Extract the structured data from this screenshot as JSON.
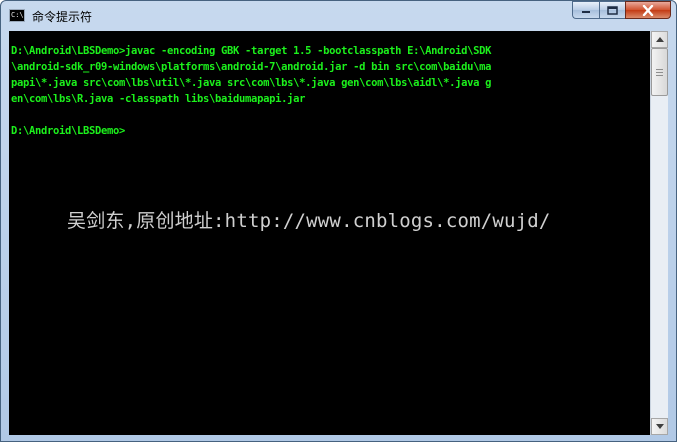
{
  "window": {
    "title": "命令提示符",
    "icon": "cmd-icon",
    "icon_text": "C:\\"
  },
  "controls": {
    "minimize_icon": "minimize-icon",
    "maximize_icon": "maximize-icon",
    "close_icon": "close-icon"
  },
  "console": {
    "lines": [
      "D:\\Android\\LBSDemo>javac -encoding GBK -target 1.5 -bootclasspath E:\\Android\\SDK",
      "\\android-sdk_r09-windows\\platforms\\android-7\\android.jar -d bin src\\com\\baidu\\ma",
      "papi\\*.java src\\com\\lbs\\util\\*.java src\\com\\lbs\\*.java gen\\com\\lbs\\aidl\\*.java g",
      "en\\com\\lbs\\R.java -classpath libs\\baidumapapi.jar",
      "",
      "D:\\Android\\LBSDemo>"
    ],
    "text_color": "#1cf11c",
    "background": "#000000"
  },
  "watermark": "吴剑东,原创地址:http://www.cnblogs.com/wujd/"
}
